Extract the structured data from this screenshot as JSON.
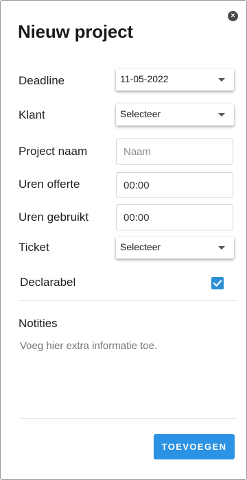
{
  "dialog": {
    "title": "Nieuw project",
    "close_icon": "close-icon"
  },
  "fields": {
    "deadline": {
      "label": "Deadline",
      "value": "11-05-2022"
    },
    "klant": {
      "label": "Klant",
      "value": "Selecteer"
    },
    "project_naam": {
      "label": "Project naam",
      "placeholder": "Naam",
      "value": ""
    },
    "uren_offerte": {
      "label": "Uren offerte",
      "value": "00:00"
    },
    "uren_gebruikt": {
      "label": "Uren gebruikt",
      "value": "00:00"
    },
    "ticket": {
      "label": "Ticket",
      "value": "Selecteer"
    },
    "declarabel": {
      "label": "Declarabel",
      "checked": true
    }
  },
  "notes": {
    "title": "Notities",
    "placeholder": "Voeg hier extra informatie toe."
  },
  "actions": {
    "submit_label": "TOEVOEGEN"
  },
  "colors": {
    "accent": "#2c92e3",
    "checkbox": "#2c8fd6",
    "text": "#1f1f1f"
  }
}
